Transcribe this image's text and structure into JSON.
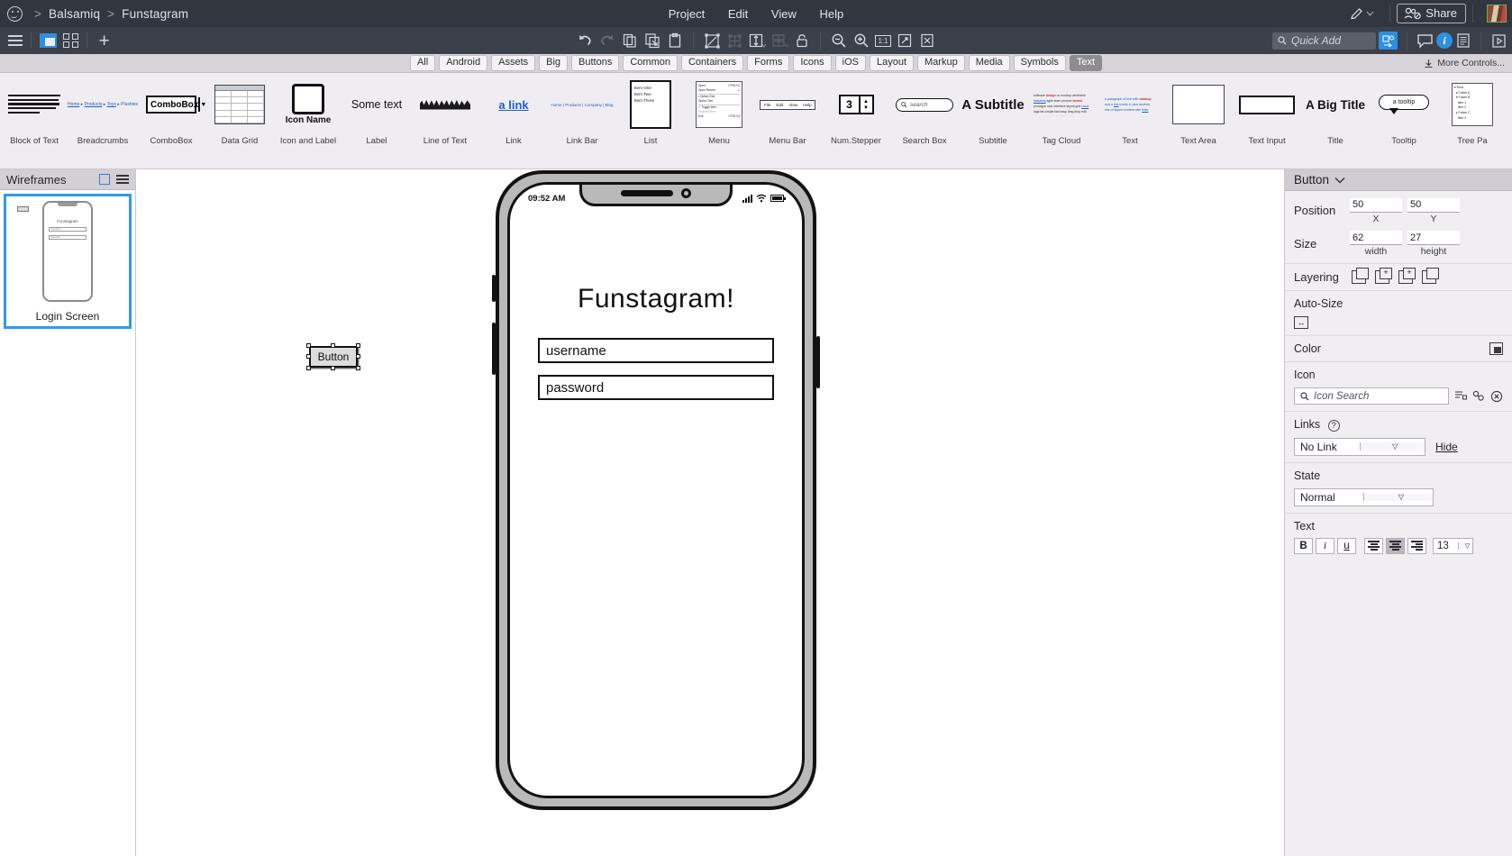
{
  "topbar": {
    "logo_icon": "smiley-face-icon",
    "breadcrumb": [
      "Balsamiq",
      "Funstagram"
    ],
    "separator": ">",
    "menus": [
      "Project",
      "Edit",
      "View",
      "Help"
    ],
    "pencil_icon": "pencil-edit-icon",
    "share_label": "Share",
    "share_icon": "people-group-icon",
    "avatar": "user-avatar"
  },
  "toolbar": {
    "hamburger_icon": "hamburger-menu-icon",
    "view_layout_icon": "panel-layout-icon",
    "view_grid_icon": "grid-view-icon",
    "add_icon": "plus-add-icon",
    "center_tools": [
      "undo-icon",
      "redo-icon",
      "copy-icon",
      "duplicate-icon",
      "paste-icon",
      "select-all-icon",
      "group-icon",
      "resize-icon",
      "align-icon",
      "lock-icon",
      "zoom-out-icon",
      "zoom-in-icon",
      "zoom-actual-size-icon",
      "fullscreen-icon",
      "export-icon"
    ],
    "zoom_actual_label": "1:1",
    "quick_add_placeholder": "Quick Add",
    "search_icon": "search-icon",
    "alt_view_icon": "alternate-view-icon",
    "comment_icon": "comment-bubble-icon",
    "info_icon": "info-circle-icon",
    "notes_icon": "notes-list-icon",
    "play_icon": "play-preview-icon"
  },
  "categories": {
    "items": [
      "All",
      "Android",
      "Assets",
      "Big",
      "Buttons",
      "Common",
      "Containers",
      "Forms",
      "Icons",
      "iOS",
      "Layout",
      "Markup",
      "Media",
      "Symbols",
      "Text"
    ],
    "active": "Text",
    "more_label": "More Controls...",
    "more_icon": "download-icon"
  },
  "palette": {
    "items": [
      {
        "label": "Block of Text",
        "thumb": "block-of-text"
      },
      {
        "label": "Breadcrumbs",
        "thumb": "breadcrumbs",
        "text": "Home > Products > Toys > Plushies"
      },
      {
        "label": "ComboBox",
        "thumb": "combobox",
        "text": "ComboBox"
      },
      {
        "label": "Data Grid",
        "thumb": "data-grid"
      },
      {
        "label": "Icon and Label",
        "thumb": "icon-and-label",
        "text": "Icon Name"
      },
      {
        "label": "Label",
        "thumb": "label",
        "text": "Some text"
      },
      {
        "label": "Line of Text",
        "thumb": "line-of-text"
      },
      {
        "label": "Link",
        "thumb": "link",
        "text": "a link"
      },
      {
        "label": "Link Bar",
        "thumb": "link-bar",
        "text": "Home | Products | Company | Blog"
      },
      {
        "label": "List",
        "thumb": "list",
        "rows": [
          "Item One",
          "Item Two",
          "Item Three"
        ]
      },
      {
        "label": "Menu",
        "thumb": "menu",
        "rows": [
          "Open",
          "Open Recent",
          "Option One",
          "Option Two",
          "Toggle Item",
          "Disabled Item",
          "Exit"
        ],
        "shortcut_open": "CTRL+O",
        "shortcut_exit": "CTRL+Q"
      },
      {
        "label": "Menu Bar",
        "thumb": "menu-bar",
        "rows": [
          "File",
          "Edit",
          "View",
          "Help"
        ]
      },
      {
        "label": "Num.Stepper",
        "thumb": "num-stepper",
        "value": "3"
      },
      {
        "label": "Search Box",
        "thumb": "search-box",
        "text": "search"
      },
      {
        "label": "Subtitle",
        "thumb": "subtitle",
        "text": "A Subtitle"
      },
      {
        "label": "Tag Cloud",
        "thumb": "tag-cloud"
      },
      {
        "label": "Text",
        "thumb": "text"
      },
      {
        "label": "Text Area",
        "thumb": "text-area"
      },
      {
        "label": "Text Input",
        "thumb": "text-input"
      },
      {
        "label": "Title",
        "thumb": "title",
        "text": "A Big Title"
      },
      {
        "label": "Tooltip",
        "thumb": "tooltip",
        "text": "a tooltip"
      },
      {
        "label": "Tree Pa",
        "thumb": "tree-pane"
      }
    ]
  },
  "sidebar": {
    "title": "Wireframes",
    "new_icon": "new-wireframe-icon",
    "menu_icon": "sidebar-menu-icon",
    "wireframes": [
      {
        "name": "Login Screen",
        "selected": true,
        "preview_title": "Funstagram",
        "preview_fields": [
          "username",
          "password"
        ]
      }
    ]
  },
  "canvas": {
    "button_widget": {
      "label": "Button",
      "selected": true
    },
    "phone": {
      "status_time": "09:52 AM",
      "signal_icon": "signal-bars-icon",
      "wifi_icon": "wifi-icon",
      "battery_icon": "battery-full-icon",
      "app_title": "Funstagram!",
      "fields": [
        {
          "name": "username-field",
          "value": "username"
        },
        {
          "name": "password-field",
          "value": "password"
        }
      ]
    }
  },
  "properties": {
    "title": "Button",
    "collapse_icon": "chevron-down-icon",
    "position": {
      "label": "Position",
      "x": "50",
      "y": "50",
      "x_sub": "X",
      "y_sub": "Y"
    },
    "size": {
      "label": "Size",
      "width": "62",
      "height": "27",
      "width_sub": "width",
      "height_sub": "height"
    },
    "layering": {
      "label": "Layering",
      "icons": [
        "bring-forward-icon",
        "bring-to-front-icon",
        "send-backward-icon",
        "send-to-back-icon"
      ]
    },
    "autosize": {
      "label": "Auto-Size",
      "icon": "auto-size-icon"
    },
    "color": {
      "label": "Color",
      "swatch_icon": "color-swatch-icon"
    },
    "icon": {
      "label": "Icon",
      "placeholder": "Icon Search",
      "search_icon": "search-icon",
      "list_icon": "icon-list-icon",
      "shape_icon": "icon-shape-icon",
      "clear_icon": "clear-icon"
    },
    "links": {
      "label": "Links",
      "help_icon": "help-question-icon",
      "value": "No Link",
      "hide_label": "Hide"
    },
    "state": {
      "label": "State",
      "value": "Normal"
    },
    "text": {
      "label": "Text",
      "bold": "B",
      "italic": "i",
      "underline": "u",
      "align_left": "align-left-icon",
      "align_center": "align-center-icon",
      "align_right": "align-right-icon",
      "align_active": "center",
      "font_size": "13"
    }
  },
  "colors": {
    "topbar_bg": "#32363f",
    "toolbar_bg": "#3b404a",
    "accent_blue": "#2d8fe0",
    "selection_blue": "#2d9bf0",
    "panel_bg": "#f0eef1",
    "palette_bg": "#f0edf2"
  }
}
